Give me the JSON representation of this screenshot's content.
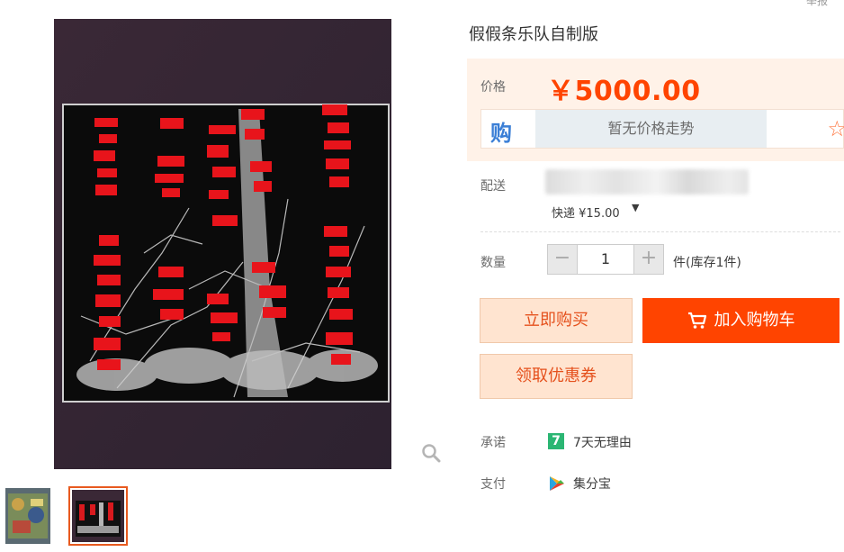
{
  "header": {
    "top_cut_text": "举报"
  },
  "product": {
    "title": "假假条乐队自制版",
    "price_label": "价格",
    "price": "￥5000.00",
    "trend_icon_text": "购",
    "trend_text": "暂无价格走势",
    "shipping_label": "配送",
    "shipping_fee": "快递 ¥15.00",
    "quantity_label": "数量",
    "quantity_value": "1",
    "stock_text": "件(库存1件)",
    "buy_now_label": "立即购买",
    "add_to_cart_label": "加入购物车",
    "coupon_label": "领取优惠券",
    "promise_label": "承诺",
    "promise_icon_text": "7",
    "promise_text": "7天无理由",
    "payment_label": "支付",
    "payment_text": "集分宝"
  },
  "colors": {
    "accent": "#ff4400",
    "price_bg": "#fff2e8",
    "button_light_bg": "#ffe4d0",
    "button_light_text": "#e5511d",
    "promise_green": "#2bb673"
  },
  "icons": [
    "zoom-icon",
    "cart-icon",
    "star-icon",
    "chevron-down-icon",
    "seven-day-icon",
    "jifenbao-icon"
  ]
}
